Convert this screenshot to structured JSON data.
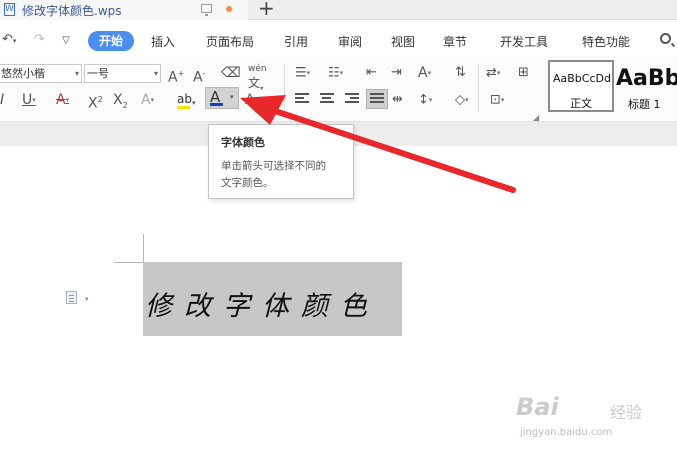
{
  "titlebar": {
    "doc_title": "修改字体颜色.wps",
    "doc_icon_letter": "W",
    "new_tab_symbol": "+"
  },
  "menubar": {
    "items": [
      "开始",
      "插入",
      "页面布局",
      "引用",
      "审阅",
      "视图",
      "章节",
      "开发工具",
      "特色功能"
    ]
  },
  "ribbon": {
    "font_name": "悠然小楷",
    "font_size": "一号",
    "pinyin_label": "wén",
    "pinyin_char": "文"
  },
  "tooltip": {
    "title": "字体颜色",
    "desc_line_1": "单击箭头可选择不同的",
    "desc_line_2": "文字颜色。"
  },
  "styles": {
    "normal_preview": "AaBbCcDd",
    "normal_label": "正文",
    "h1_preview": "AaBb",
    "h1_label": "标题 1"
  },
  "document": {
    "selected_text": "修改字体颜色"
  },
  "watermark": {
    "brand": "Bai",
    "brand_cn": "经验",
    "url": "jingyan.baidu.com"
  },
  "colors": {
    "accent": "#4a8ef0",
    "font_color_bar": "#1240b8",
    "highlight_bar": "#f3e600",
    "annotation_arrow": "#e8282b",
    "selection": "#c7c7c7"
  },
  "icons": [
    "doc-icon",
    "monitor-icon",
    "undo-icon",
    "redo-icon",
    "search-icon",
    "font-color-icon",
    "highlight-icon",
    "paragraph-icon"
  ]
}
